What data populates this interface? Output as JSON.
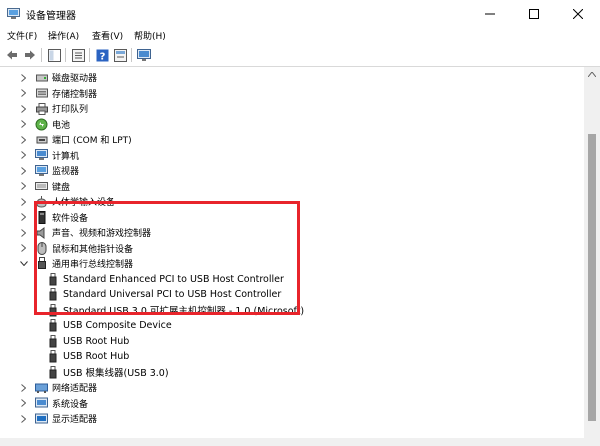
{
  "window": {
    "title": "设备管理器"
  },
  "menu": [
    {
      "label": "文件(F)"
    },
    {
      "label": "操作(A)"
    },
    {
      "label": "查看(V)"
    },
    {
      "label": "帮助(H)"
    }
  ],
  "toolbar": {
    "buttons": [
      {
        "icon": "back-arrow-icon"
      },
      {
        "icon": "forward-arrow-icon"
      },
      {
        "icon": "properties-icon"
      },
      {
        "icon": "show-hide-icon"
      },
      {
        "icon": "help-icon"
      },
      {
        "icon": "action-view-icon"
      },
      {
        "icon": "monitor-icon"
      }
    ]
  },
  "tree": {
    "categories": [
      {
        "label": "磁盘驱动器",
        "icon": "disk-drive-icon",
        "expanded": false
      },
      {
        "label": "存储控制器",
        "icon": "storage-controller-icon",
        "expanded": false
      },
      {
        "label": "打印队列",
        "icon": "printer-icon",
        "expanded": false
      },
      {
        "label": "电池",
        "icon": "battery-icon",
        "expanded": false
      },
      {
        "label": "端口 (COM 和 LPT)",
        "icon": "port-icon",
        "expanded": false
      },
      {
        "label": "计算机",
        "icon": "computer-icon",
        "expanded": false
      },
      {
        "label": "监视器",
        "icon": "monitor-icon",
        "expanded": false
      },
      {
        "label": "键盘",
        "icon": "keyboard-icon",
        "expanded": false
      },
      {
        "label": "人体学输入设备",
        "icon": "hid-icon",
        "expanded": false
      },
      {
        "label": "软件设备",
        "icon": "software-device-icon",
        "expanded": false
      },
      {
        "label": "声音、视频和游戏控制器",
        "icon": "speaker-icon",
        "expanded": false
      },
      {
        "label": "鼠标和其他指针设备",
        "icon": "mouse-icon",
        "expanded": false
      },
      {
        "label": "通用串行总线控制器",
        "icon": "usb-icon",
        "expanded": true
      }
    ],
    "usb_children": [
      {
        "label": "Standard Enhanced PCI to USB Host Controller"
      },
      {
        "label": "Standard Universal PCI to USB Host Controller"
      },
      {
        "label": "Standard USB 3.0 可扩展主机控制器 - 1.0 (Microsoft)"
      },
      {
        "label": "USB Composite Device"
      },
      {
        "label": "USB Root Hub"
      },
      {
        "label": "USB Root Hub"
      },
      {
        "label": "USB 根集线器(USB 3.0)"
      }
    ],
    "after_categories": [
      {
        "label": "网络适配器",
        "icon": "network-adapter-icon",
        "expanded": false
      },
      {
        "label": "系统设备",
        "icon": "system-device-icon",
        "expanded": false
      },
      {
        "label": "显示适配器",
        "icon": "display-adapter-icon",
        "expanded": false
      }
    ]
  },
  "highlight": {
    "color": "#e8242b"
  }
}
